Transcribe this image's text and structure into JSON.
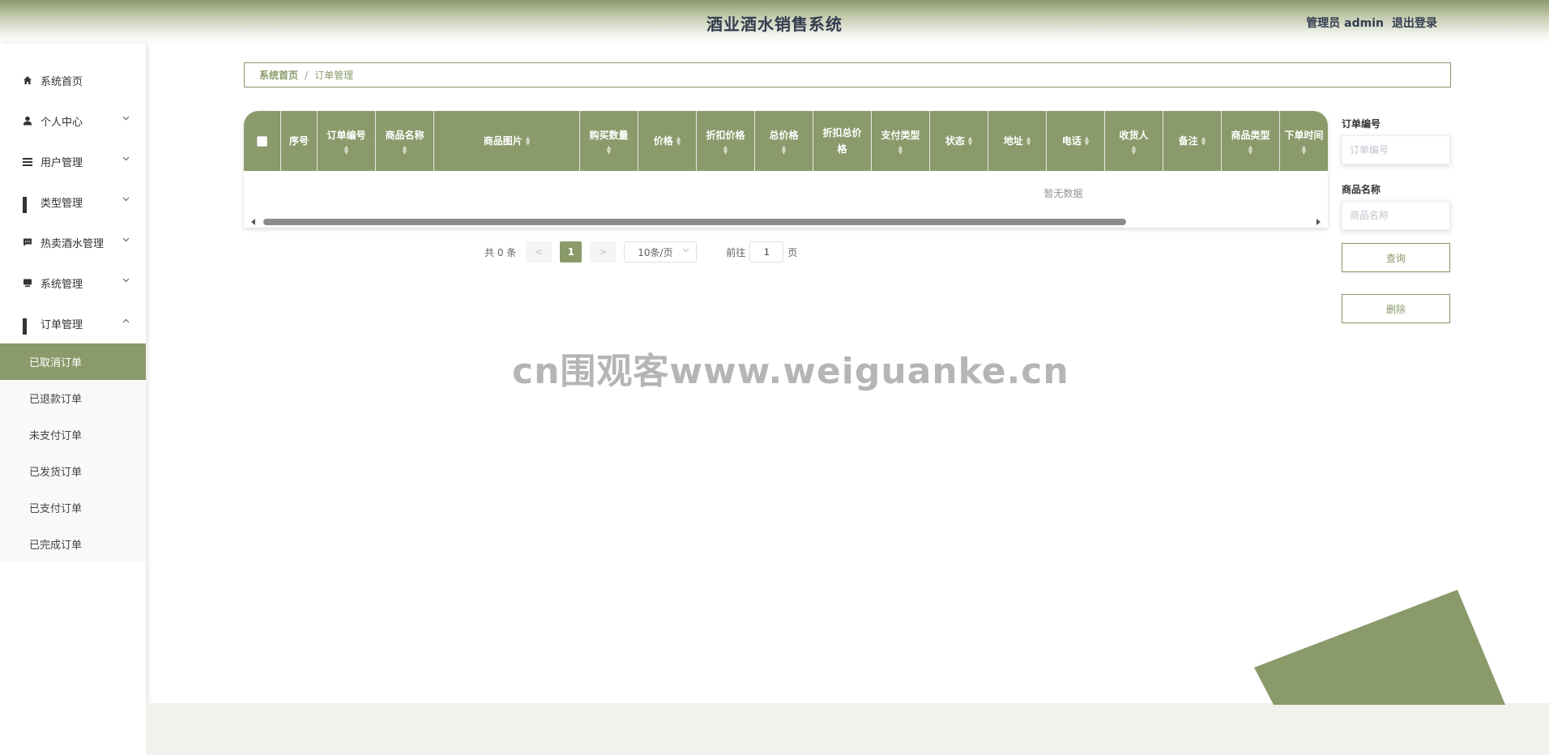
{
  "header": {
    "title": "酒业酒水销售系统",
    "user_label": "管理员 admin",
    "logout_label": "退出登录"
  },
  "sidebar": {
    "items": [
      {
        "label": "系统首页",
        "icon": "home-icon"
      },
      {
        "label": "个人中心",
        "icon": "user-icon"
      },
      {
        "label": "用户管理",
        "icon": "list-icon"
      },
      {
        "label": "类型管理",
        "icon": "grid-icon"
      },
      {
        "label": "热卖酒水管理",
        "icon": "message-icon"
      },
      {
        "label": "系统管理",
        "icon": "monitor-icon"
      },
      {
        "label": "订单管理",
        "icon": "grid-icon"
      }
    ],
    "submenu": [
      {
        "label": "已取消订单",
        "active": true
      },
      {
        "label": "已退款订单"
      },
      {
        "label": "未支付订单"
      },
      {
        "label": "已发货订单"
      },
      {
        "label": "已支付订单"
      },
      {
        "label": "已完成订单"
      }
    ]
  },
  "breadcrumb": {
    "home": "系统首页",
    "separator": "/",
    "current": "订单管理"
  },
  "table": {
    "columns": [
      "序号",
      "订单编号",
      "商品名称",
      "商品图片",
      "购买数量",
      "价格",
      "折扣价格",
      "总价格",
      "折扣总价格",
      "支付类型",
      "状态",
      "地址",
      "电话",
      "收货人",
      "备注",
      "商品类型",
      "下单时间"
    ],
    "empty_text": "暂无数据"
  },
  "pagination": {
    "total_text": "共 0 条",
    "prev": "<",
    "current_page": "1",
    "next": ">",
    "page_size": "10条/页",
    "goto_prefix": "前往",
    "goto_value": "1",
    "goto_suffix": "页"
  },
  "search": {
    "order_no_label": "订单编号",
    "order_no_placeholder": "订单编号",
    "product_name_label": "商品名称",
    "product_name_placeholder": "商品名称",
    "query_button": "查询",
    "delete_button": "删除"
  },
  "watermark": "cn围观客www.weiguanke.cn",
  "colors": {
    "accent": "#8b9a6b",
    "text_dark": "#333d4f"
  }
}
